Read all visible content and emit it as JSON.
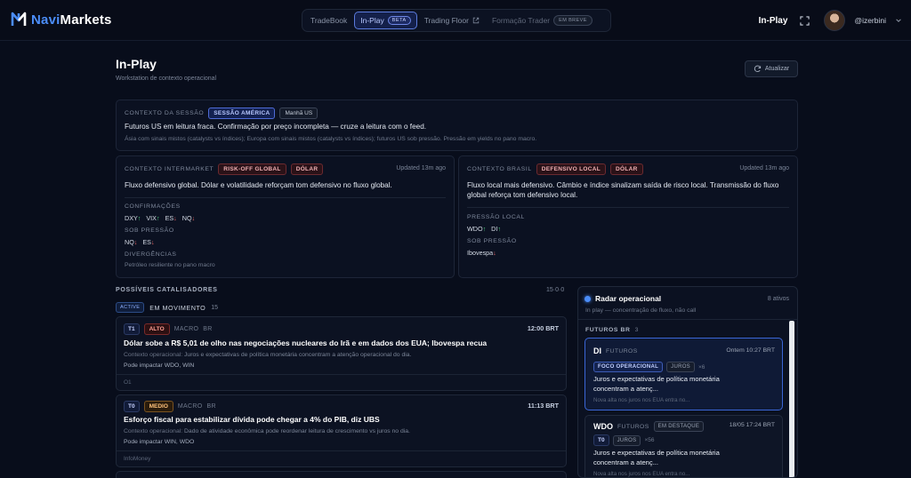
{
  "brand": {
    "part1": "Navi",
    "part2": "Markets"
  },
  "nav": {
    "tradebook": "TradeBook",
    "inplay": "In-Play",
    "inplay_badge": "BETA",
    "tradingfloor": "Trading Floor",
    "formacao": "Formação Trader",
    "formacao_badge": "EM BREVE"
  },
  "header": {
    "title": "In-Play",
    "username": "@izerbini"
  },
  "page": {
    "title": "In-Play",
    "subtitle": "Workstation de contexto operacional",
    "refresh_label": "Atualizar"
  },
  "session": {
    "label": "CONTEXTO DA SESSÃO",
    "tag1": "SESSÃO AMÉRICA",
    "tag2": "Manhã US",
    "headline": "Futuros US em leitura fraca. Confirmação por preço incompleta — cruze a leitura com o feed.",
    "detail": "Ásia com sinais mistos (catalysts vs índices); Europa com sinais mistos (catalysts vs índices); futuros US sob pressão. Pressão em yields no pano macro."
  },
  "intermarket": {
    "label": "CONTEXTO INTERMARKET",
    "tag1": "RISK-OFF GLOBAL",
    "tag2": "DÓLAR",
    "updated": "Updated 13m ago",
    "headline": "Fluxo defensivo global. Dólar e volatilidade reforçam tom defensivo no fluxo global.",
    "confirm_label": "CONFIRMAÇÕES",
    "confirm": [
      {
        "sym": "DXY",
        "arrow": "↑",
        "dir": "up"
      },
      {
        "sym": "VIX",
        "arrow": "↑",
        "dir": "up"
      },
      {
        "sym": "ES",
        "arrow": "↓",
        "dir": "dn"
      },
      {
        "sym": "NQ",
        "arrow": "↓",
        "dir": "dn"
      }
    ],
    "pressure_label": "SOB PRESSÃO",
    "pressure": [
      {
        "sym": "NQ",
        "arrow": "↓",
        "dir": "dn"
      },
      {
        "sym": "ES",
        "arrow": "↓",
        "dir": "dn"
      }
    ],
    "div_label": "DIVERGÊNCIAS",
    "div_text": "Petróleo resiliente no pano macro"
  },
  "brasil": {
    "label": "CONTEXTO BRASIL",
    "tag1": "DEFENSIVO LOCAL",
    "tag2": "DÓLAR",
    "updated": "Updated 13m ago",
    "headline": "Fluxo local mais defensivo. Câmbio e índice sinalizam saída de risco local. Transmissão do fluxo global reforça tom defensivo local.",
    "local_label": "PRESSÃO LOCAL",
    "local": [
      {
        "sym": "WDO",
        "arrow": "↑",
        "dir": "up"
      },
      {
        "sym": "DI",
        "arrow": "↑",
        "dir": "up"
      }
    ],
    "pressure_label": "SOB PRESSÃO",
    "pressure": [
      {
        "sym": "Ibovespa",
        "arrow": "↓",
        "dir": "dn"
      }
    ]
  },
  "catalysts": {
    "title": "POSSÍVEIS CATALISADORES",
    "count": "15·0·0",
    "active_badge": "ACTIVE",
    "moving_label": "EM MOVIMENTO",
    "moving_count": "15",
    "items": [
      {
        "tier": "T1",
        "priority": "ALTO",
        "category": "MACRO",
        "region": "BR",
        "time": "12:00 BRT",
        "title": "Dólar sobe a R$ 5,01 de olho nas negociações nucleares do Irã e em dados dos EUA; Ibovespa recua",
        "context_label": "Contexto operacional:",
        "context": "Juros e expectativas de política monetária concentram a atenção operacional do dia.",
        "impact": "Pode impactar WDO, WIN",
        "source": "O1"
      },
      {
        "tier": "T0",
        "priority": "MEDIO",
        "category": "MACRO",
        "region": "BR",
        "time": "11:13 BRT",
        "title": "Esforço fiscal para estabilizar dívida pode chegar a 4% do PIB, diz UBS",
        "context_label": "Contexto operacional:",
        "context": "Dado de atividade econômica pode reordenar leitura de crescimento vs juros no dia.",
        "impact": "Pode impactar WIN, WDO",
        "source": "InfoMoney"
      }
    ]
  },
  "radar": {
    "title": "Radar operacional",
    "count": "8 ativos",
    "subtitle": "In play — concentração de fluxo, não call",
    "group_label": "FUTUROS BR",
    "group_count": "3",
    "assets": [
      {
        "sym": "DI",
        "kind": "FUTUROS",
        "time": "Ontem 10:27 BRT",
        "tags": [
          "FOCO OPERACIONAL",
          "JUROS"
        ],
        "mult": "×6",
        "body": "Juros e expectativas de política monetária concentram a atenç...",
        "foot": "Nova alta nos juros nos EUA entra no..."
      },
      {
        "sym": "WDO",
        "kind": "FUTUROS",
        "badge": "EM DESTAQUE",
        "time": "18/05 17:24 BRT",
        "tier": "T0",
        "tags": [
          "JUROS"
        ],
        "mult": "×56",
        "body": "Juros e expectativas de política monetária concentram a atenç...",
        "foot": "Nova alta nos juros nos EUA entra no..."
      }
    ]
  }
}
